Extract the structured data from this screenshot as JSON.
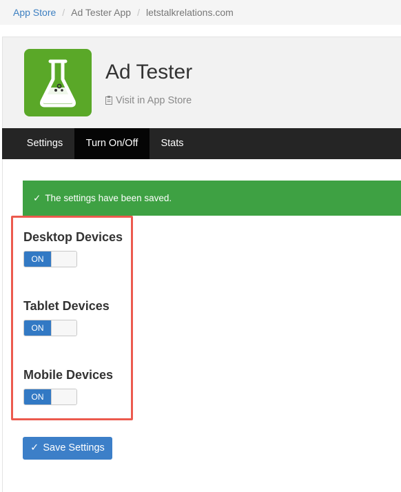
{
  "breadcrumb": {
    "items": [
      "App Store",
      "Ad Tester App",
      "letstalkrelations.com"
    ],
    "separator": "/"
  },
  "app": {
    "title": "Ad Tester",
    "store_link": "Visit in App Store",
    "icon": "flask-icon",
    "icon_color": "#5aa828"
  },
  "tabs": [
    {
      "label": "Settings",
      "active": false
    },
    {
      "label": "Turn On/Off",
      "active": true
    },
    {
      "label": "Stats",
      "active": false
    }
  ],
  "alert": {
    "icon": "check-icon",
    "message": "The settings have been saved.",
    "color": "#3ea143"
  },
  "devices": [
    {
      "label": "Desktop Devices",
      "toggle": "ON",
      "enabled": true
    },
    {
      "label": "Tablet Devices",
      "toggle": "ON",
      "enabled": true
    },
    {
      "label": "Mobile Devices",
      "toggle": "ON",
      "enabled": true
    }
  ],
  "save_button": {
    "icon": "check-icon",
    "label": "Save Settings",
    "color": "#3c7fc8"
  },
  "highlight_color": "#ec5a4e"
}
